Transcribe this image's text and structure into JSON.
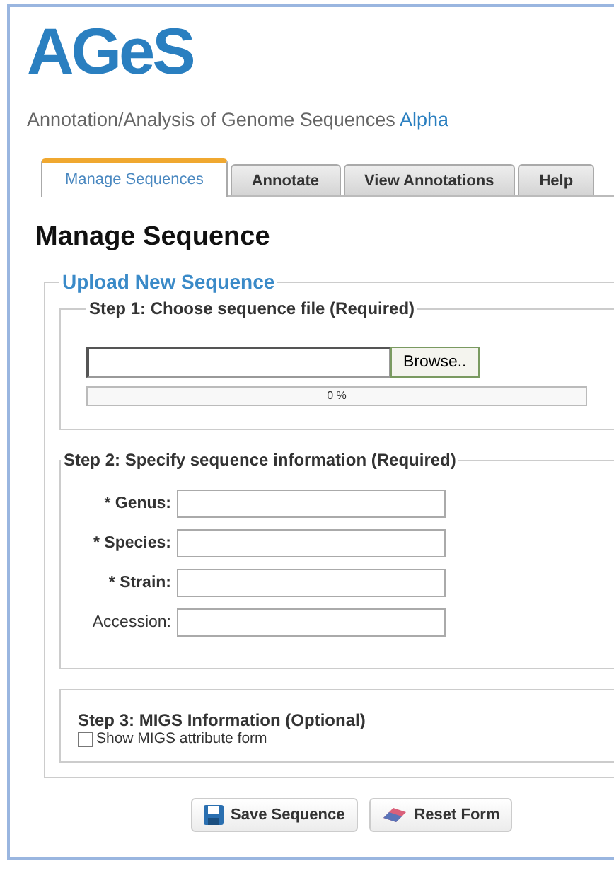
{
  "logo": "AGeS",
  "subtitle": {
    "text": "Annotation/Analysis of Genome Sequences",
    "tag": "Alpha"
  },
  "tabs": [
    {
      "label": "Manage Sequences",
      "selected": true
    },
    {
      "label": "Annotate",
      "selected": false
    },
    {
      "label": "View Annotations",
      "selected": false
    },
    {
      "label": "Help",
      "selected": false
    }
  ],
  "heading": "Manage Sequence",
  "upload": {
    "legend": "Upload New Sequence",
    "step1": {
      "legend": "Step 1: Choose sequence file (Required)",
      "browse": "Browse..",
      "progress": {
        "level": 0,
        "reading": "0 %"
      }
    },
    "step2": {
      "legend": "Step 2: Specify sequence information (Required)",
      "fields": [
        {
          "label": "* Genus:",
          "required": true
        },
        {
          "label": "* Species:",
          "required": true
        },
        {
          "label": "* Strain:",
          "required": true
        },
        {
          "label": "Accession:",
          "required": false
        }
      ]
    },
    "step3": {
      "title": "Step 3: MIGS Information (Optional)",
      "checkbox": {
        "label": "Show MIGS attribute form",
        "checked": false
      }
    }
  },
  "buttons": [
    {
      "label": "Save Sequence",
      "kind": "save"
    },
    {
      "label": "Reset Form",
      "kind": "reset"
    }
  ]
}
